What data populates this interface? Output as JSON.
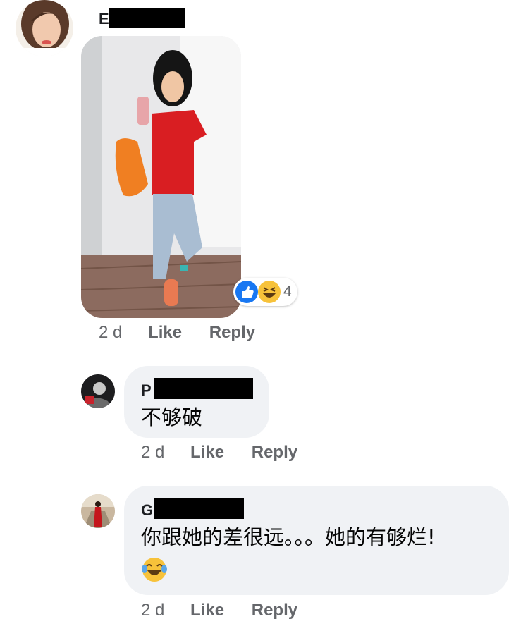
{
  "comments": [
    {
      "author_initial": "E",
      "timestamp": "2 d",
      "like_label": "Like",
      "reply_label": "Reply",
      "reaction_count": "4",
      "reaction_icons": [
        "like-reaction",
        "haha-reaction"
      ]
    },
    {
      "author_initial": "P",
      "text": "不够破",
      "timestamp": "2 d",
      "like_label": "Like",
      "reply_label": "Reply"
    },
    {
      "author_initial": "G",
      "text": "你跟她的差很远。。。她的有够烂!",
      "emoji": "😂",
      "timestamp": "2 d",
      "like_label": "Like",
      "reply_label": "Reply"
    }
  ],
  "colors": {
    "bubble": "#f0f2f5",
    "meta": "#65676b",
    "like_blue": "#1877f2",
    "haha_yellow": "#f7c23a"
  }
}
